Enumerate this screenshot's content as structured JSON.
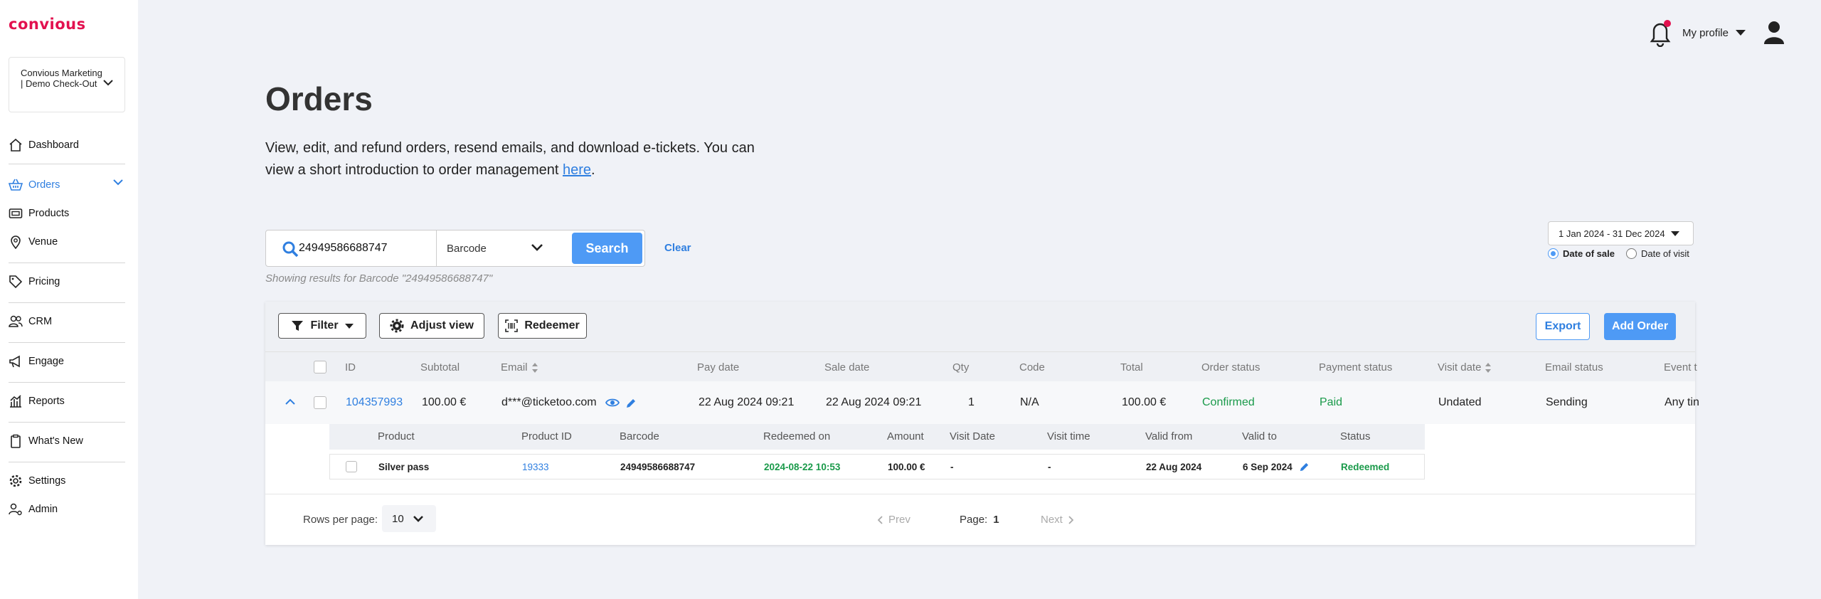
{
  "brand": {
    "logo": "convious"
  },
  "sidebar": {
    "org_name": "Convious Marketing | Demo Check-Out",
    "items": [
      {
        "label": "Dashboard",
        "icon": "home-icon"
      },
      {
        "label": "Orders",
        "icon": "basket-icon"
      },
      {
        "label": "Products",
        "icon": "ticket-icon"
      },
      {
        "label": "Venue",
        "icon": "pin-icon"
      },
      {
        "label": "Pricing",
        "icon": "tag-icon"
      },
      {
        "label": "CRM",
        "icon": "users-icon"
      },
      {
        "label": "Engage",
        "icon": "megaphone-icon"
      },
      {
        "label": "Reports",
        "icon": "chart-icon"
      },
      {
        "label": "What's New",
        "icon": "clipboard-icon"
      },
      {
        "label": "Settings",
        "icon": "gear-icon"
      },
      {
        "label": "Admin",
        "icon": "user-gear-icon"
      }
    ]
  },
  "topbar": {
    "profile_label": "My profile"
  },
  "page": {
    "title": "Orders",
    "intro_text": "View, edit, and refund orders, resend emails, and download e-tickets. You can view a short introduction to order management ",
    "intro_link": "here",
    "intro_end": "."
  },
  "search": {
    "value": "24949586688747",
    "field_option": "Barcode",
    "button": "Search",
    "clear": "Clear",
    "results_text": "Showing results for Barcode \"24949586688747\""
  },
  "date_filter": {
    "range": "1 Jan 2024 - 31 Dec 2024",
    "options": [
      "Date of sale",
      "Date of visit"
    ],
    "selected": "Date of sale"
  },
  "toolbar": {
    "filter": "Filter",
    "adjust_view": "Adjust view",
    "redeemer": "Redeemer",
    "export": "Export",
    "add_order": "Add Order"
  },
  "table": {
    "columns": [
      "ID",
      "Subtotal",
      "Email",
      "Pay date",
      "Sale date",
      "Qty",
      "Code",
      "Total",
      "Order status",
      "Payment status",
      "Visit date",
      "Email status",
      "Event t"
    ],
    "row": {
      "id": "104357993",
      "subtotal": "100.00 €",
      "email": "d***@ticketoo.com",
      "pay_date": "22 Aug 2024 09:21",
      "sale_date": "22 Aug 2024 09:21",
      "qty": "1",
      "code": "N/A",
      "total": "100.00 €",
      "order_status": "Confirmed",
      "payment_status": "Paid",
      "visit_date": "Undated",
      "email_status": "Sending",
      "event": "Any tin"
    }
  },
  "subtable": {
    "columns": [
      "Product",
      "Product ID",
      "Barcode",
      "Redeemed on",
      "Amount",
      "Visit Date",
      "Visit time",
      "Valid from",
      "Valid to",
      "Status"
    ],
    "row": {
      "product": "Silver pass",
      "product_id": "19333",
      "barcode": "24949586688747",
      "redeemed_on": "2024-08-22 10:53",
      "amount": "100.00 €",
      "visit_date": "-",
      "visit_time": "-",
      "valid_from": "22 Aug 2024",
      "valid_to": "6 Sep 2024",
      "status": "Redeemed"
    }
  },
  "pagination": {
    "rows_label": "Rows per page:",
    "rows_value": "10",
    "prev": "Prev",
    "page_label": "Page:",
    "page": "1",
    "next": "Next"
  },
  "colors": {
    "brand": "#e2114f",
    "accent": "#4e9af5",
    "link": "#2f7fe0",
    "success": "#1a9a4a"
  }
}
